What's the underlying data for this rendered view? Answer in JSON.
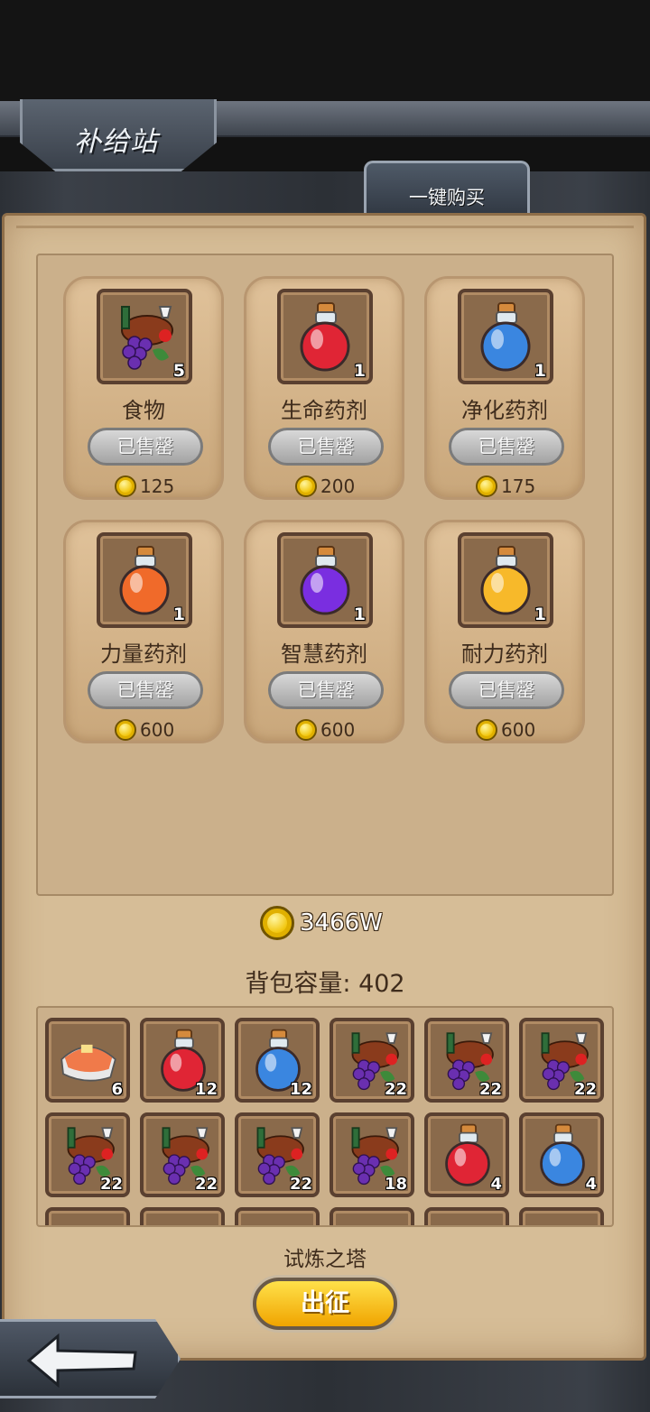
{
  "header": {
    "title": "补给站"
  },
  "toolbar": {
    "buy_all_label": "一键购买"
  },
  "shop": {
    "items": [
      {
        "name": "食物",
        "count": "5",
        "status": "已售罄",
        "price": "125",
        "icon": "food-icon"
      },
      {
        "name": "生命药剂",
        "count": "1",
        "status": "已售罄",
        "price": "200",
        "icon": "red-potion-icon"
      },
      {
        "name": "净化药剂",
        "count": "1",
        "status": "已售罄",
        "price": "175",
        "icon": "blue-potion-icon"
      },
      {
        "name": "力量药剂",
        "count": "1",
        "status": "已售罄",
        "price": "600",
        "icon": "orange-potion-icon"
      },
      {
        "name": "智慧药剂",
        "count": "1",
        "status": "已售罄",
        "price": "600",
        "icon": "purple-potion-icon"
      },
      {
        "name": "耐力药剂",
        "count": "1",
        "status": "已售罄",
        "price": "600",
        "icon": "yellow-potion-icon"
      }
    ]
  },
  "wallet": {
    "gold": "3466W"
  },
  "bag": {
    "title": "背包容量: 402",
    "slots": [
      {
        "icon": "salmon-steak-icon",
        "count": "6"
      },
      {
        "icon": "red-potion-icon",
        "count": "12"
      },
      {
        "icon": "blue-potion-icon",
        "count": "12"
      },
      {
        "icon": "food-icon",
        "count": "22"
      },
      {
        "icon": "food-icon",
        "count": "22"
      },
      {
        "icon": "food-icon",
        "count": "22"
      },
      {
        "icon": "food-icon",
        "count": "22"
      },
      {
        "icon": "food-icon",
        "count": "22"
      },
      {
        "icon": "food-icon",
        "count": "22"
      },
      {
        "icon": "food-icon",
        "count": "18"
      },
      {
        "icon": "red-potion-icon",
        "count": "4"
      },
      {
        "icon": "blue-potion-icon",
        "count": "4"
      }
    ]
  },
  "footer": {
    "location": "试炼之塔",
    "go_label": "出征"
  },
  "colors": {
    "red": "#e02535",
    "blue": "#3a86e0",
    "orange": "#f06a2a",
    "purple": "#7a2ee0",
    "yellow": "#f7b92a",
    "panel": "#d6bd97"
  }
}
